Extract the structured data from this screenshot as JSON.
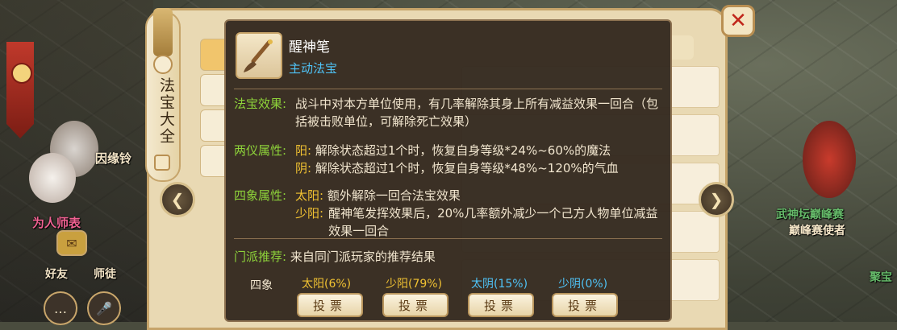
{
  "window": {
    "title_vertical": "法宝大全",
    "close_symbol": "✕",
    "prev_symbol": "❮",
    "next_symbol": "❯"
  },
  "background_ui": {
    "npc_labels": [
      {
        "text": "因缘铃",
        "color": "#f5e6c8"
      },
      {
        "text": "为人师表",
        "color": "#f06292"
      },
      {
        "text": "武神坛巅峰赛",
        "color": "#66bb6a"
      },
      {
        "text": "巅峰赛使者",
        "color": "#f5e6c8"
      },
      {
        "text": "聚宝",
        "color": "#66bb6a"
      }
    ],
    "bottom_buttons": [
      "好友",
      "师徒"
    ]
  },
  "item": {
    "name": "醒神笔",
    "type": "主动法宝",
    "effect_label": "法宝效果:",
    "effect_text": "战斗中对本方单位使用，有几率解除其身上所有减益效果一回合（包括被击败单位，可解除死亡效果）",
    "liangyi_label": "两仪属性:",
    "liangyi": [
      {
        "name": "阳:",
        "text": "解除状态超过1个时，恢复自身等级*24%~60%的魔法"
      },
      {
        "name": "阴:",
        "text": "解除状态超过1个时，恢复自身等级*48%~120%的气血"
      }
    ],
    "sixiang_label": "四象属性:",
    "sixiang": [
      {
        "name": "太阳:",
        "text": "额外解除一回合法宝效果"
      },
      {
        "name": "少阳:",
        "text": "醒神笔发挥效果后，20%几率额外减少一个己方人物单位减益效果一回合"
      }
    ],
    "recommend_label": "门派推荐:",
    "recommend_text": "来自同门派玩家的推荐结果",
    "vote_row_label": "四象",
    "votes": [
      {
        "caption": "太阳(6%)",
        "caption_color": "#f1c232",
        "button": "投票",
        "share": 6
      },
      {
        "caption": "少阳(79%)",
        "caption_color": "#f1c232",
        "button": "投票",
        "share": 79
      },
      {
        "caption": "太阴(15%)",
        "caption_color": "#4fc3f7",
        "button": "投票",
        "share": 15
      },
      {
        "caption": "少阴(0%)",
        "caption_color": "#4fc3f7",
        "button": "投票",
        "share": 0
      }
    ]
  }
}
